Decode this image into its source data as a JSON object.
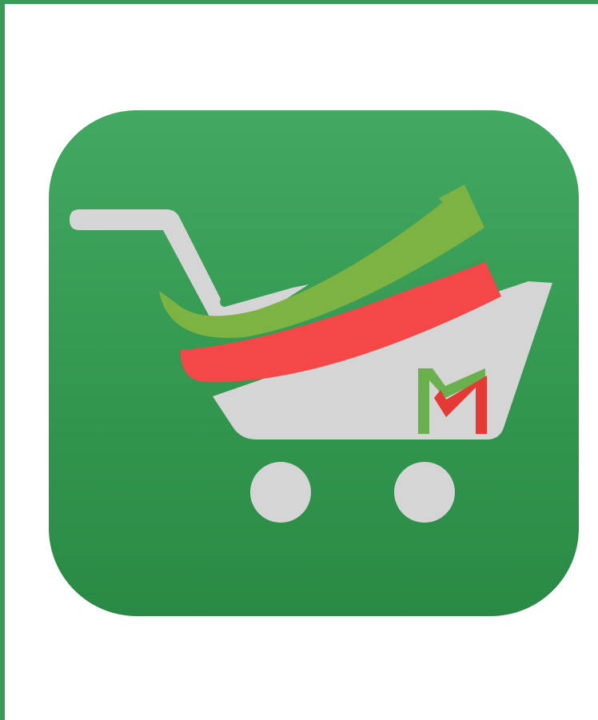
{
  "app": {
    "name": "",
    "logo_monogram": "M"
  },
  "colors": {
    "frame_border": "#3a9a58",
    "icon_background_top": "#43a862",
    "icon_background_bottom": "#2a8a45",
    "cart_body": "#d5d5d5",
    "swoosh_green": "#7cb342",
    "swoosh_red": "#f44747",
    "monogram_green": "#6ab04c",
    "monogram_red": "#e53935"
  },
  "icons": [
    "shopping-cart-icon",
    "swoosh-check-icon",
    "m-monogram-icon"
  ]
}
